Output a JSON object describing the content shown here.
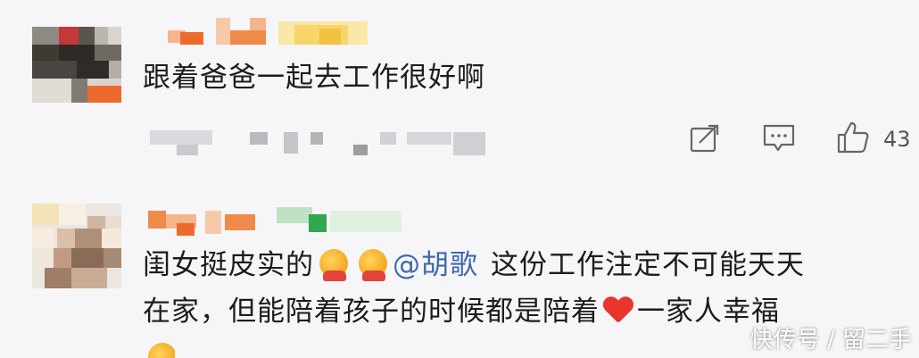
{
  "comments": [
    {
      "text": "跟着爸爸一起去工作很好啊",
      "like_count": "43"
    },
    {
      "text_before_mention": "闺女挺皮实的",
      "mention": "@胡歌",
      "text_after_mention": "这份工作注定不可能天天",
      "text_line2_before_heart": "在家，但能陪着孩子的时候都是陪着",
      "text_line2_after_heart": "一家人幸福"
    }
  ],
  "icons": {
    "share": "share-icon",
    "reply": "comment-icon",
    "like": "thumbs-up-icon",
    "emoji": "hugging-face-emoji-icon",
    "heart": "red-heart-emoji-icon"
  },
  "watermark": "快传号 / 留二手",
  "colors": {
    "background": "#f6f6f8",
    "mention": "#3e6aa8",
    "heart": "#e8352e"
  }
}
